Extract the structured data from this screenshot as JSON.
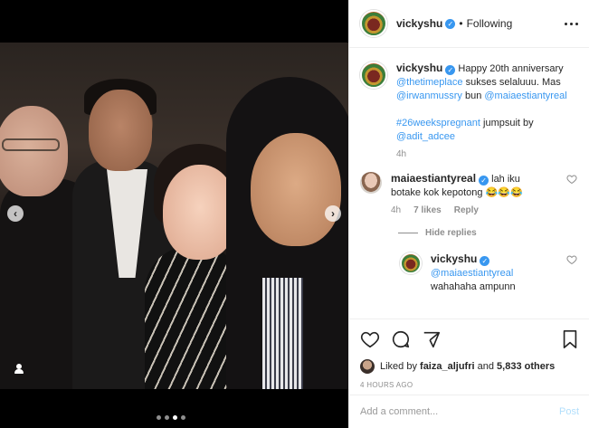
{
  "post": {
    "nav_prev": "‹",
    "nav_next": "›",
    "carousel_dots": 4,
    "carousel_active_index": 2
  },
  "header": {
    "username": "vickyshu",
    "separator": "•",
    "follow_status": "Following"
  },
  "caption": {
    "username": "vickyshu",
    "text_1": " Happy 20th anniversary ",
    "mention_1": "@thetimeplace",
    "text_2": " sukses selaluuu. Mas ",
    "mention_2": "@irwanmussry",
    "text_3": " bun ",
    "mention_3": "@maiaestiantyreal",
    "hashtag": "#26weekspregnant",
    "text_4": " jumpsuit by ",
    "mention_4": "@adit_adcee",
    "time": "4h"
  },
  "comment_1": {
    "username": "maiaestiantyreal",
    "text": " lah iku botake kok kepotong 😂😂😂",
    "time": "4h",
    "likes": "7 likes",
    "reply_label": "Reply"
  },
  "hide_replies": "Hide replies",
  "reply_1": {
    "username": "vickyshu",
    "mention": "@maiaestiantyreal",
    "text": " wahahaha ampunn"
  },
  "likes": {
    "liked_by_prefix": "Liked by ",
    "liked_by_user": "faiza_aljufri",
    "liked_by_suffix": " and ",
    "others": "5,833 others"
  },
  "timestamp": "4 HOURS AGO",
  "add_comment": {
    "placeholder": "Add a comment...",
    "post_label": "Post"
  },
  "colors": {
    "link": "#3897f0",
    "verified": "#3897f0",
    "post_disabled": "#b2dffc",
    "muted": "#8e8e8e"
  }
}
